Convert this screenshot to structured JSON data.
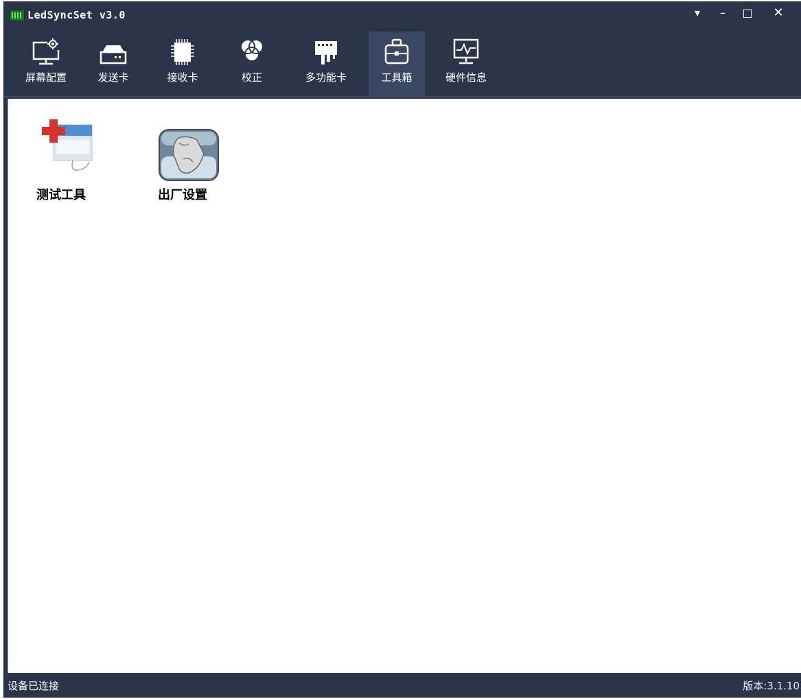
{
  "window": {
    "title": "LedSyncSet v3.0",
    "controls": {
      "dropdown": "▾",
      "minimize": "–",
      "maximize": "□",
      "close": "✕"
    }
  },
  "toolbar": {
    "items": [
      {
        "label": "屏幕配置",
        "icon": "monitor-gear-icon",
        "active": false
      },
      {
        "label": "发送卡",
        "icon": "sender-card-icon",
        "active": false
      },
      {
        "label": "接收卡",
        "icon": "chip-icon",
        "active": false
      },
      {
        "label": "校正",
        "icon": "color-circles-icon",
        "active": false
      },
      {
        "label": "多功能卡",
        "icon": "multifunction-card-icon",
        "active": false
      },
      {
        "label": "工具箱",
        "icon": "toolbox-icon",
        "active": true
      },
      {
        "label": "硬件信息",
        "icon": "hardware-monitor-icon",
        "active": false
      }
    ]
  },
  "tools": [
    {
      "label": "测试工具",
      "icon": "test-tool-icon"
    },
    {
      "label": "出厂设置",
      "icon": "factory-settings-icon"
    }
  ],
  "status": {
    "left": "设备已连接",
    "right": "版本:3.1.10"
  },
  "colors": {
    "chrome": "#2a3549",
    "active_tab": "#3b4863",
    "content_bg": "#ffffff"
  }
}
